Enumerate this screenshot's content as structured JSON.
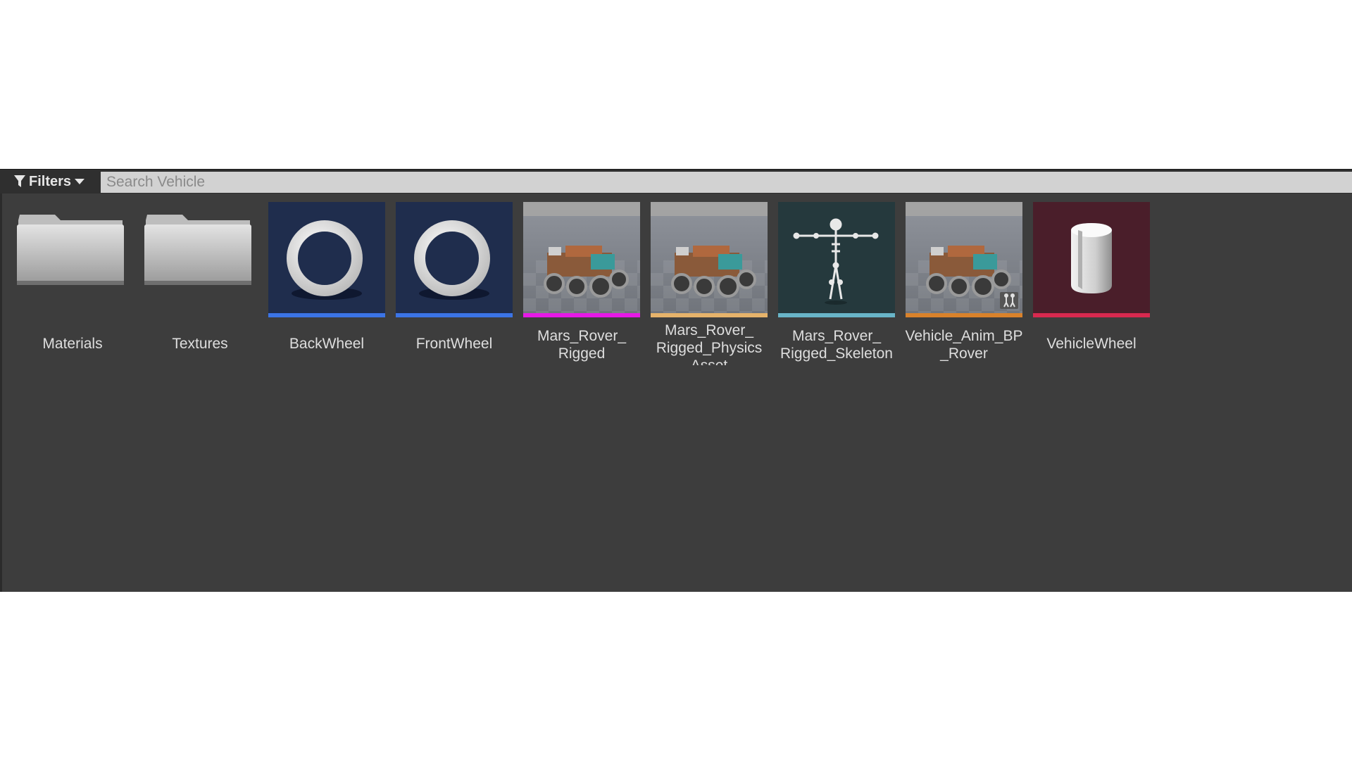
{
  "toolbar": {
    "filters_label": "Filters",
    "search_placeholder": "Search Vehicle"
  },
  "assets": [
    {
      "label": "Materials",
      "type": "folder"
    },
    {
      "label": "Textures",
      "type": "folder"
    },
    {
      "label": "BackWheel",
      "type": "wheel",
      "bar_color": "#3b74e6"
    },
    {
      "label": "FrontWheel",
      "type": "wheel",
      "bar_color": "#3b74e6"
    },
    {
      "label": "Mars_Rover_\nRigged",
      "type": "skeletal-mesh",
      "bar_color": "#e619e6"
    },
    {
      "label": "Mars_Rover_\nRigged_Physics\nAsset",
      "type": "physics-asset",
      "bar_color": "#e6b36b"
    },
    {
      "label": "Mars_Rover_\nRigged_Skeleton",
      "type": "skeleton",
      "bar_color": "#69b5c8"
    },
    {
      "label": "Vehicle_Anim_BP\n_Rover",
      "type": "anim-blueprint",
      "bar_color": "#d9822b"
    },
    {
      "label": "VehicleWheel",
      "type": "blueprint",
      "bar_color": "#d8294f"
    }
  ]
}
